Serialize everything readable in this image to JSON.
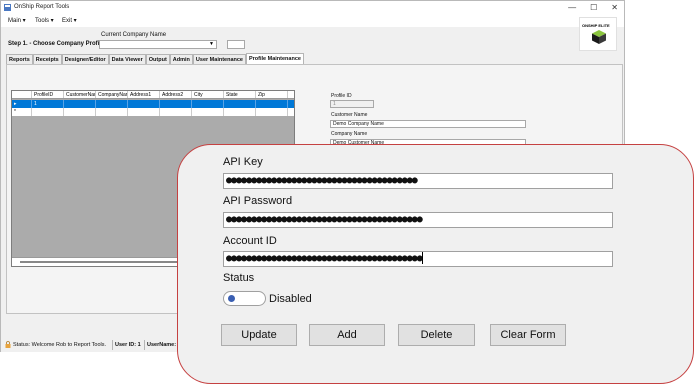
{
  "window": {
    "title": "OnShip Report Tools",
    "controls": {
      "minimize": "—",
      "maximize": "☐",
      "close": "✕"
    }
  },
  "menu": {
    "main": "Main ▾",
    "tools": "Tools ▾",
    "exit": "Exit ▾"
  },
  "step": {
    "label": "Step 1. - Choose Company Profile",
    "company_caption": "Current Company Name",
    "company_value": ""
  },
  "logo": {
    "text": "ONSHIP ELITE"
  },
  "tabs": [
    "Reports",
    "Receipts",
    "Designer/Editor",
    "Data Viewer",
    "Output",
    "Admin",
    "User Maintenance",
    "Profile Maintenance"
  ],
  "active_tab": "Profile Maintenance",
  "grid": {
    "columns": [
      "ProfileID",
      "CustomerNar",
      "CompanyNar",
      "Address1",
      "Address2",
      "City",
      "State",
      "Zip"
    ],
    "rows": [
      {
        "marker": "▸",
        "cells": [
          "1",
          "",
          "",
          "",
          "",
          "",
          "",
          ""
        ]
      },
      {
        "marker": "*",
        "cells": [
          "",
          "",
          "",
          "",
          "",
          "",
          "",
          ""
        ]
      }
    ]
  },
  "form": {
    "profile_id_label": "Profile ID",
    "profile_id_value": "1",
    "customer_name_label": "Customer Name",
    "customer_name_value": "Demo Company Name",
    "company_name_label": "Company Name",
    "company_name_value": "Demo Customer Name"
  },
  "status": {
    "message": "Status: Welcome Rob to Report Tools.",
    "user_id": "User ID: 1",
    "username": "UserName:"
  },
  "zoom": {
    "api_key_label": "API Key",
    "api_key_value": "●●●●●●●●●●●●●●●●●●●●●●●●●●●●●●●●●●●●●●",
    "api_password_label": "API Password",
    "api_password_value": "●●●●●●●●●●●●●●●●●●●●●●●●●●●●●●●●●●●●●●●",
    "account_id_label": "Account ID",
    "account_id_value": "●●●●●●●●●●●●●●●●●●●●●●●●●●●●●●●●●●●●●●●",
    "status_label": "Status",
    "status_toggle": "Disabled",
    "buttons": {
      "update": "Update",
      "add": "Add",
      "delete": "Delete",
      "clear": "Clear Form"
    }
  },
  "colors": {
    "selection": "#0078d7",
    "callout_border": "#c54141",
    "toggle_knob": "#3a5fb2"
  }
}
